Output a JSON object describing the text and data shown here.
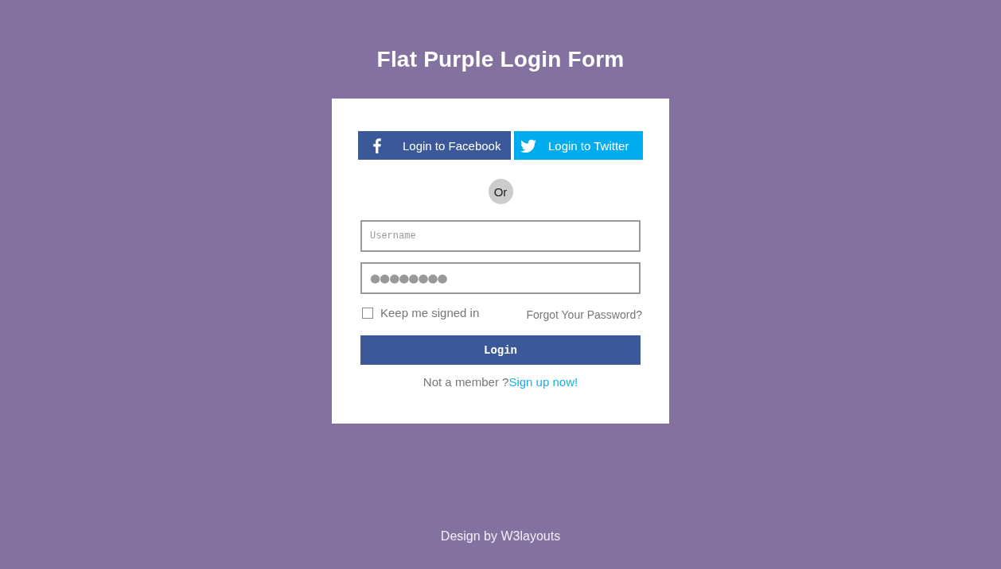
{
  "title": "Flat Purple Login Form",
  "social_buttons": [
    {
      "kind": "facebook",
      "label": "Login to Facebook"
    },
    {
      "kind": "twitter",
      "label": "Login to Twitter"
    }
  ],
  "divider": "Or",
  "username": {
    "placeholder": "Username"
  },
  "password": {
    "value": "●●●●●●●●"
  },
  "remember": {
    "label": "Keep me signed in",
    "checked": false
  },
  "forgot_link": "Forgot Your Password?",
  "login_button": "Login",
  "signup": {
    "text": "Not a member ?",
    "link": "Sign up now!"
  },
  "footer": "Design by W3layouts"
}
